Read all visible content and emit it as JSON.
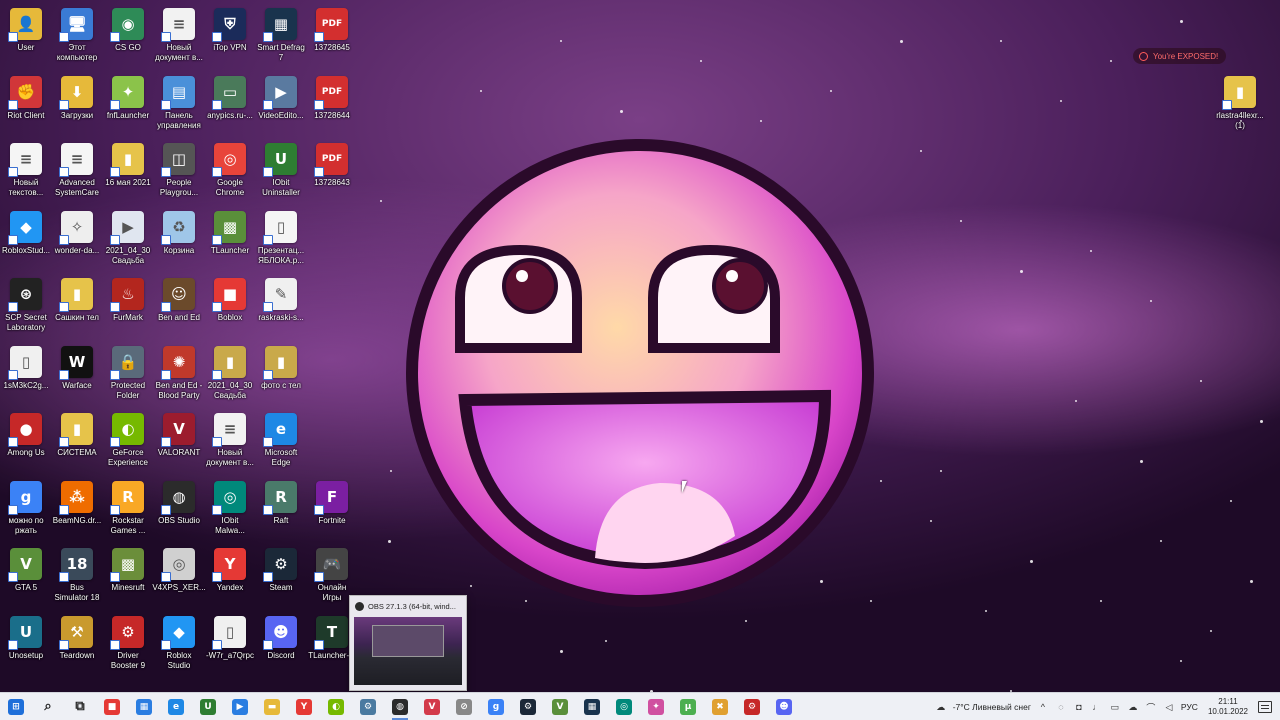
{
  "desktop": {
    "icons": [
      {
        "label": "User",
        "icon": "user-folder-icon",
        "color": "#e6b93a",
        "glyph": "👤",
        "col": 0,
        "row": 0
      },
      {
        "label": "Этот\nкомпьютер",
        "icon": "computer-icon",
        "color": "#3a7bd5",
        "glyph": "🖥",
        "col": 1,
        "row": 0
      },
      {
        "label": "CS GO",
        "icon": "csgo-globe-icon",
        "color": "#2e8b57",
        "glyph": "◉",
        "col": 2,
        "row": 0
      },
      {
        "label": "Новый\nдокумент в...",
        "icon": "document-icon",
        "color": "#f2f2f2",
        "glyph": "≡",
        "col": 3,
        "row": 0
      },
      {
        "label": "iTop VPN",
        "icon": "shield-icon",
        "color": "#1b2b5a",
        "glyph": "⛨",
        "col": 4,
        "row": 0
      },
      {
        "label": "Smart Defrag\n7",
        "icon": "defrag-icon",
        "color": "#19334d",
        "glyph": "▦",
        "col": 5,
        "row": 0
      },
      {
        "label": "13728645",
        "icon": "pdf-icon",
        "color": "#d32f2f",
        "glyph": "PDF",
        "col": 6,
        "row": 0
      },
      {
        "label": "Riot Client",
        "icon": "riot-icon",
        "color": "#d13639",
        "glyph": "✊",
        "col": 0,
        "row": 1
      },
      {
        "label": "Загрузки",
        "icon": "downloads-folder-icon",
        "color": "#e6b93a",
        "glyph": "⬇",
        "col": 1,
        "row": 1
      },
      {
        "label": "fnfLauncher",
        "icon": "fnf-launcher-icon",
        "color": "#8bc34a",
        "glyph": "✦",
        "col": 2,
        "row": 1
      },
      {
        "label": "Панель\nуправления",
        "icon": "control-panel-icon",
        "color": "#4a90d9",
        "glyph": "▤",
        "col": 3,
        "row": 1
      },
      {
        "label": "anypics.ru-...",
        "icon": "image-icon",
        "color": "#4a7a5a",
        "glyph": "▭",
        "col": 4,
        "row": 1
      },
      {
        "label": "VideoEdito...",
        "icon": "video-editor-icon",
        "color": "#5a7aa0",
        "glyph": "▶",
        "col": 5,
        "row": 1
      },
      {
        "label": "13728644",
        "icon": "pdf-icon",
        "color": "#d32f2f",
        "glyph": "PDF",
        "col": 6,
        "row": 1
      },
      {
        "label": "Новый\nтекстов...",
        "icon": "text-file-icon",
        "color": "#f5f5f5",
        "glyph": "≡",
        "col": 0,
        "row": 2
      },
      {
        "label": "Advanced\nSystemCare",
        "icon": "text-file-icon",
        "color": "#f5f5f5",
        "glyph": "≡",
        "col": 1,
        "row": 2
      },
      {
        "label": "16 мая 2021",
        "icon": "zip-folder-icon",
        "color": "#e6c34a",
        "glyph": "▮",
        "col": 2,
        "row": 2
      },
      {
        "label": "People\nPlaygrou...",
        "icon": "people-playground-icon",
        "color": "#555",
        "glyph": "◫",
        "col": 3,
        "row": 2
      },
      {
        "label": "Google\nChrome",
        "icon": "chrome-icon",
        "color": "#e8443a",
        "glyph": "◎",
        "col": 4,
        "row": 2
      },
      {
        "label": "IObit\nUninstaller",
        "icon": "iobit-uninstaller-icon",
        "color": "#2e7d32",
        "glyph": "U",
        "col": 5,
        "row": 2
      },
      {
        "label": "13728643",
        "icon": "pdf-icon",
        "color": "#d32f2f",
        "glyph": "PDF",
        "col": 6,
        "row": 2
      },
      {
        "label": "RobloxStud...",
        "icon": "roblox-studio-icon",
        "color": "#2196f3",
        "glyph": "◆",
        "col": 0,
        "row": 3
      },
      {
        "label": "wonder-da...",
        "icon": "wonder-image-icon",
        "color": "#eee",
        "glyph": "✧",
        "col": 1,
        "row": 3
      },
      {
        "label": "2021_04_30\nСвадьба",
        "icon": "video-file-icon",
        "color": "#e0e6f0",
        "glyph": "▶",
        "col": 2,
        "row": 3
      },
      {
        "label": "Корзина",
        "icon": "recycle-bin-icon",
        "color": "#9fc6e8",
        "glyph": "♻",
        "col": 3,
        "row": 3
      },
      {
        "label": "TLauncher",
        "icon": "tlauncher-icon",
        "color": "#5a8f3a",
        "glyph": "▩",
        "col": 4,
        "row": 3
      },
      {
        "label": "Презентац...\nЯБЛОКА.р...",
        "icon": "presentation-icon",
        "color": "#f5f5f5",
        "glyph": "▯",
        "col": 5,
        "row": 3
      },
      {
        "label": "SCP Secret\nLaboratory",
        "icon": "scp-icon",
        "color": "#222",
        "glyph": "⊛",
        "col": 0,
        "row": 4
      },
      {
        "label": "Сашкин тел",
        "icon": "zip-folder-icon",
        "color": "#e6c34a",
        "glyph": "▮",
        "col": 1,
        "row": 4
      },
      {
        "label": "FurMark",
        "icon": "furmark-icon",
        "color": "#b3261e",
        "glyph": "♨",
        "col": 2,
        "row": 4
      },
      {
        "label": "Ben and Ed",
        "icon": "ben-and-ed-icon",
        "color": "#6b4a2b",
        "glyph": "☺",
        "col": 3,
        "row": 4
      },
      {
        "label": "Boblox",
        "icon": "roblox-icon",
        "color": "#e53935",
        "glyph": "■",
        "col": 4,
        "row": 4
      },
      {
        "label": "raskraski-s...",
        "icon": "coloring-image-icon",
        "color": "#f0f0f0",
        "glyph": "✎",
        "col": 5,
        "row": 4
      },
      {
        "label": "1sM3kC2g...",
        "icon": "file-icon",
        "color": "#f0f0f0",
        "glyph": "▯",
        "col": 0,
        "row": 5
      },
      {
        "label": "Warface",
        "icon": "warface-icon",
        "color": "#111",
        "glyph": "W",
        "col": 1,
        "row": 5
      },
      {
        "label": "Protected\nFolder",
        "icon": "lock-folder-icon",
        "color": "#5a6a7a",
        "glyph": "🔒",
        "col": 2,
        "row": 5
      },
      {
        "label": "Ben and Ed -\nBlood Party",
        "icon": "brain-icon",
        "color": "#c0392b",
        "glyph": "✺",
        "col": 3,
        "row": 5
      },
      {
        "label": "2021_04_30\nСвадьба",
        "icon": "zip-folder-icon",
        "color": "#c9a94a",
        "glyph": "▮",
        "col": 4,
        "row": 5
      },
      {
        "label": "фото с тел",
        "icon": "zip-folder-icon",
        "color": "#c9a94a",
        "glyph": "▮",
        "col": 5,
        "row": 5
      },
      {
        "label": "Among Us",
        "icon": "among-us-icon",
        "color": "#c62828",
        "glyph": "●",
        "col": 0,
        "row": 6
      },
      {
        "label": "СИСТЕМА",
        "icon": "zip-folder-icon",
        "color": "#e6c34a",
        "glyph": "▮",
        "col": 1,
        "row": 6
      },
      {
        "label": "GeForce\nExperience",
        "icon": "nvidia-icon",
        "color": "#76b900",
        "glyph": "◐",
        "col": 2,
        "row": 6
      },
      {
        "label": "VALORANT",
        "icon": "valorant-icon",
        "color": "#9c1c2e",
        "glyph": "V",
        "col": 3,
        "row": 6
      },
      {
        "label": "Новый\nдокумент в...",
        "icon": "document-icon",
        "color": "#f2f2f2",
        "glyph": "≡",
        "col": 4,
        "row": 6
      },
      {
        "label": "Microsoft\nEdge",
        "icon": "edge-icon",
        "color": "#1e88e5",
        "glyph": "e",
        "col": 5,
        "row": 6
      },
      {
        "label": "можно по\nржать",
        "icon": "g-app-icon",
        "color": "#3b82f6",
        "glyph": "g",
        "col": 0,
        "row": 7
      },
      {
        "label": "BeamNG.dr...",
        "icon": "beamng-icon",
        "color": "#ef6c00",
        "glyph": "⁂",
        "col": 1,
        "row": 7
      },
      {
        "label": "Rockstar\nGames ...",
        "icon": "rockstar-icon",
        "color": "#f9a825",
        "glyph": "R",
        "col": 2,
        "row": 7
      },
      {
        "label": "OBS Studio",
        "icon": "obs-icon",
        "color": "#2b2b2b",
        "glyph": "◍",
        "col": 3,
        "row": 7
      },
      {
        "label": "IObit\nMalwa...",
        "icon": "iobit-malware-icon",
        "color": "#00897b",
        "glyph": "◎",
        "col": 4,
        "row": 7
      },
      {
        "label": "Raft",
        "icon": "raft-icon",
        "color": "#4a7a6a",
        "glyph": "R",
        "col": 5,
        "row": 7
      },
      {
        "label": "Fortnite",
        "icon": "fortnite-icon",
        "color": "#7b1fa2",
        "glyph": "F",
        "col": 6,
        "row": 7
      },
      {
        "label": "GTA 5",
        "icon": "gta5-icon",
        "color": "#5a8f3a",
        "glyph": "V",
        "col": 0,
        "row": 8
      },
      {
        "label": "Bus\nSimulator 18",
        "icon": "bus-simulator-icon",
        "color": "#3a4a5a",
        "glyph": "18",
        "col": 1,
        "row": 8
      },
      {
        "label": "Minesruft",
        "icon": "minecraft-icon",
        "color": "#6b8e3a",
        "glyph": "▩",
        "col": 2,
        "row": 8
      },
      {
        "label": "V4XPS_XER...",
        "icon": "disc-icon",
        "color": "#d0d0d0",
        "glyph": "◎",
        "col": 3,
        "row": 8
      },
      {
        "label": "Yandex",
        "icon": "yandex-icon",
        "color": "#e53935",
        "glyph": "Y",
        "col": 4,
        "row": 8
      },
      {
        "label": "Steam",
        "icon": "steam-icon",
        "color": "#1b2838",
        "glyph": "⚙",
        "col": 5,
        "row": 8
      },
      {
        "label": "Онлайн\nИгры",
        "icon": "gamepad-icon",
        "color": "#444",
        "glyph": "🎮",
        "col": 6,
        "row": 8
      },
      {
        "label": "Unosetup",
        "icon": "uno-icon",
        "color": "#1a6e8a",
        "glyph": "U",
        "col": 0,
        "row": 9
      },
      {
        "label": "Teardown",
        "icon": "teardown-icon",
        "color": "#c99a2e",
        "glyph": "⚒",
        "col": 1,
        "row": 9
      },
      {
        "label": "Driver\nBooster 9",
        "icon": "driver-booster-icon",
        "color": "#c62828",
        "glyph": "⚙",
        "col": 2,
        "row": 9
      },
      {
        "label": "Roblox\nStudio",
        "icon": "roblox-studio-icon",
        "color": "#2196f3",
        "glyph": "◆",
        "col": 3,
        "row": 9
      },
      {
        "label": "-W7r_a7Qrpc",
        "icon": "file-icon",
        "color": "#f0f0f0",
        "glyph": "▯",
        "col": 4,
        "row": 9
      },
      {
        "label": "Discord",
        "icon": "discord-icon",
        "color": "#5865f2",
        "glyph": "☻",
        "col": 5,
        "row": 9
      },
      {
        "label": "TLauncher-...",
        "icon": "tlauncher-icon",
        "color": "#1e3a2a",
        "glyph": "T",
        "col": 6,
        "row": 9
      }
    ],
    "right_icon": {
      "label": "rlastra4llexr...\n(1)",
      "icon": "zip-folder-icon",
      "color": "#e6c34a",
      "glyph": "▮"
    },
    "exposed_badge": "You're EXPOSED!"
  },
  "preview": {
    "title": "OBS 27.1.3 (64-bit, wind..."
  },
  "taskbar": {
    "apps": [
      {
        "name": "start-button",
        "icon": "windows-start-icon",
        "color": "#1e6fd9",
        "glyph": "⊞"
      },
      {
        "name": "search-button",
        "icon": "search-icon",
        "color": "#eef0f5",
        "glyph": "⌕"
      },
      {
        "name": "task-view-button",
        "icon": "task-view-icon",
        "color": "#eef0f5",
        "glyph": "⧉"
      },
      {
        "name": "taskbar-app-roblox",
        "icon": "roblox-icon",
        "color": "#e53935",
        "glyph": "■"
      },
      {
        "name": "taskbar-app-store",
        "icon": "store-icon",
        "color": "#2a7de1",
        "glyph": "▦"
      },
      {
        "name": "taskbar-app-edge",
        "icon": "edge-icon",
        "color": "#1e88e5",
        "glyph": "e"
      },
      {
        "name": "taskbar-app-iobit",
        "icon": "iobit-uninstaller-icon",
        "color": "#2e7d32",
        "glyph": "U"
      },
      {
        "name": "taskbar-app-media",
        "icon": "media-player-icon",
        "color": "#2a7de1",
        "glyph": "▶"
      },
      {
        "name": "taskbar-app-explorer",
        "icon": "folder-icon",
        "color": "#e6b93a",
        "glyph": "▬"
      },
      {
        "name": "taskbar-app-yandex",
        "icon": "yandex-icon",
        "color": "#e53935",
        "glyph": "Y"
      },
      {
        "name": "taskbar-app-nvidia",
        "icon": "nvidia-icon",
        "color": "#76b900",
        "glyph": "◐"
      },
      {
        "name": "taskbar-app-settings",
        "icon": "settings-icon",
        "color": "#4a7aa0",
        "glyph": "⚙"
      },
      {
        "name": "taskbar-app-obs",
        "icon": "obs-icon",
        "color": "#2b2b2b",
        "glyph": "◍"
      },
      {
        "name": "taskbar-app-valorant",
        "icon": "valorant-icon",
        "color": "#d33a4a",
        "glyph": "V"
      },
      {
        "name": "taskbar-app-riot",
        "icon": "compass-icon",
        "color": "#888",
        "glyph": "⊘"
      },
      {
        "name": "taskbar-app-g",
        "icon": "g-app-icon",
        "color": "#3b82f6",
        "glyph": "g"
      },
      {
        "name": "taskbar-app-steam",
        "icon": "steam-icon",
        "color": "#1b2838",
        "glyph": "⚙"
      },
      {
        "name": "taskbar-app-gta",
        "icon": "gta5-icon",
        "color": "#5a8f3a",
        "glyph": "V"
      },
      {
        "name": "taskbar-app-defrag",
        "icon": "defrag-icon",
        "color": "#19334d",
        "glyph": "▦"
      },
      {
        "name": "taskbar-app-malware",
        "icon": "iobit-malware-icon",
        "color": "#00897b",
        "glyph": "◎"
      },
      {
        "name": "taskbar-app-fnf",
        "icon": "fnf-launcher-icon",
        "color": "#d050a0",
        "glyph": "✦"
      },
      {
        "name": "taskbar-app-torrent",
        "icon": "utorrent-icon",
        "color": "#4caf50",
        "glyph": "µ"
      },
      {
        "name": "taskbar-app-cs",
        "icon": "csgo-icon",
        "color": "#e0a030",
        "glyph": "✖"
      },
      {
        "name": "taskbar-app-driverbooster",
        "icon": "driver-booster-icon",
        "color": "#c62828",
        "glyph": "⚙"
      },
      {
        "name": "taskbar-app-discord",
        "icon": "discord-icon",
        "color": "#5865f2",
        "glyph": "☻"
      }
    ],
    "active_app": "taskbar-app-obs",
    "weather": "-7°C  Ливневый снег",
    "language": "РУС",
    "time": "21:11",
    "date": "10.01.2022"
  }
}
